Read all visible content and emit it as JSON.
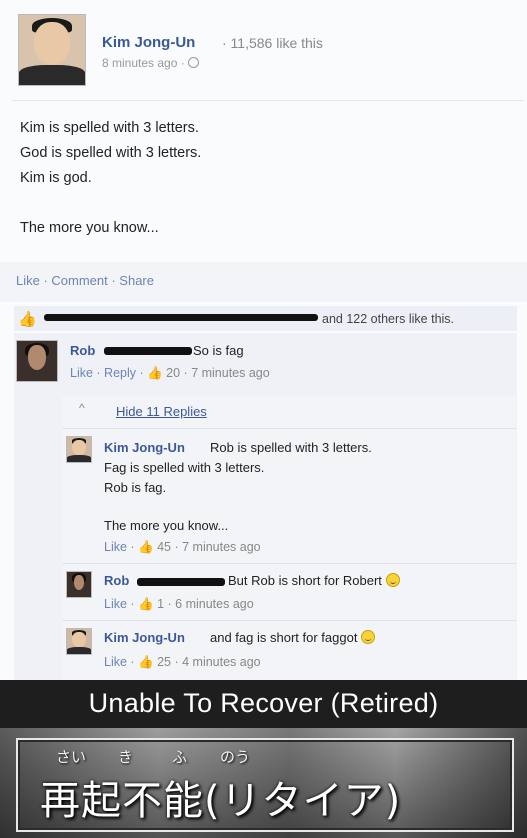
{
  "post": {
    "author": "Kim Jong-Un",
    "likes_count": "· 11,586 like this",
    "timestamp": "8 minutes ago ·",
    "body": [
      "Kim is spelled with 3 letters.",
      "God is spelled with 3 letters.",
      "Kim is god.",
      "The more you know..."
    ],
    "actions": "Like · Comment · Share",
    "likes_summary": "and 122 others like this."
  },
  "comments": [
    {
      "name": "Rob",
      "text": "So is fag",
      "meta_like": "Like",
      "meta_reply": "· Reply ·",
      "meta_rest": "👍 20 · 7 minutes ago"
    }
  ],
  "hide_replies": "Hide 11 Replies",
  "replies": [
    {
      "name": "Kim Jong-Un",
      "lines": [
        "Rob is spelled with 3 letters.",
        "Fag is spelled with 3 letters.",
        "Rob is fag.",
        "The more you know..."
      ],
      "meta_like": "Like",
      "meta_rest": "· 👍 45 · 7 minutes ago"
    },
    {
      "name": "Rob",
      "text": "But Rob is short for Robert",
      "meta_like": "Like",
      "meta_rest": "· 👍 1 · 6 minutes ago"
    },
    {
      "name": "Kim Jong-Un",
      "text": "and fag is short for faggot",
      "meta_like": "Like",
      "meta_rest": "· 👍 25 · 4 minutes ago"
    }
  ],
  "meme": {
    "caption": "Unable To Recover (Retired)",
    "furigana": [
      "さい",
      "き",
      "ふ",
      "のう"
    ],
    "japanese": "再起不能(リタイア)"
  }
}
